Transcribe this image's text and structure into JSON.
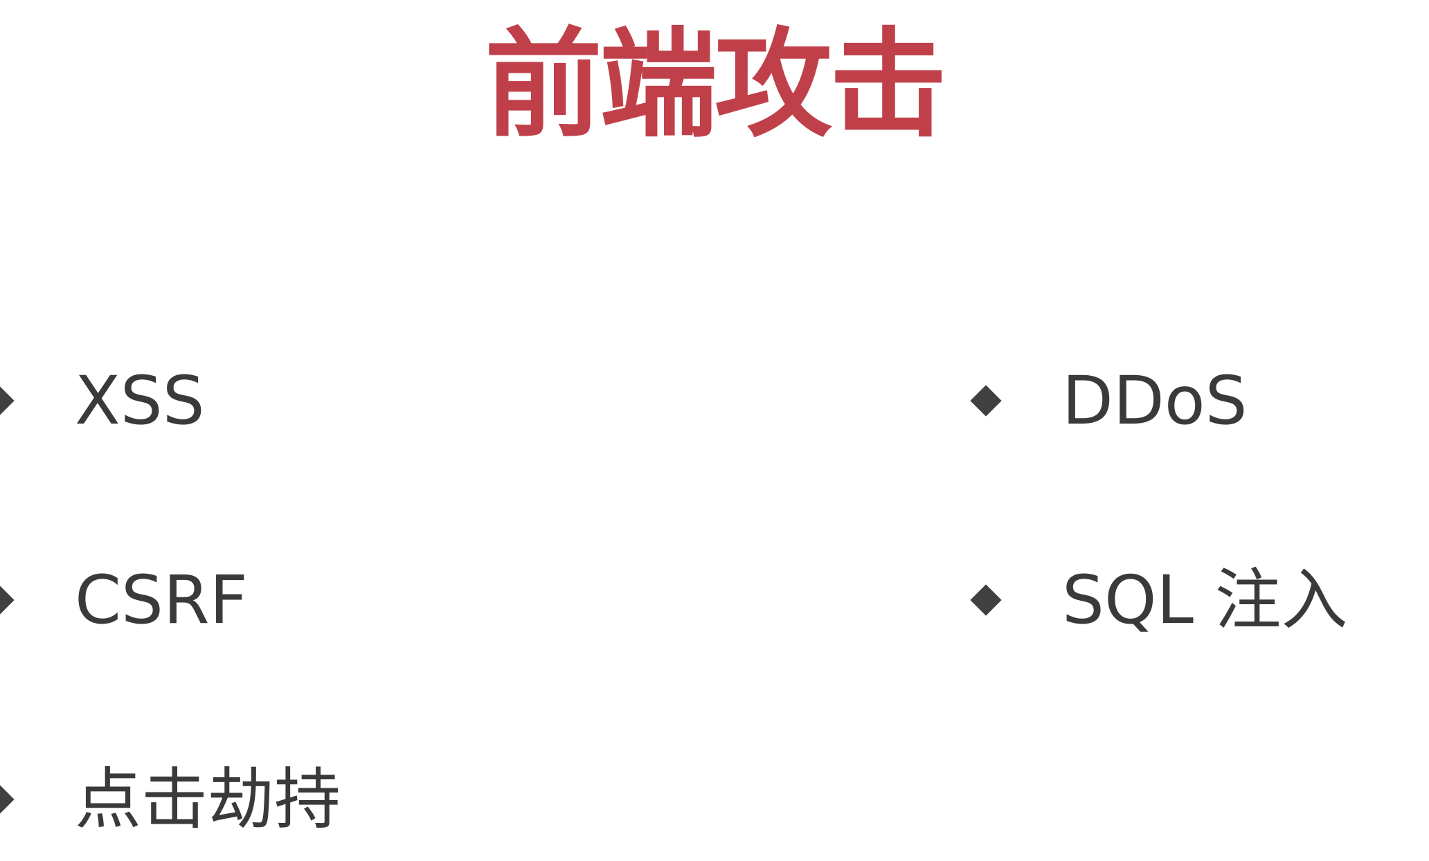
{
  "title": "前端攻击",
  "colors": {
    "title": "#c0404a",
    "text": "#3a3a3a",
    "bullet": "#404040"
  },
  "bullet_icon": "diamond-bullet-icon",
  "left_items": [
    {
      "label": "XSS"
    },
    {
      "label": "CSRF"
    },
    {
      "label": "点击劫持"
    }
  ],
  "right_items": [
    {
      "label": "DDoS"
    },
    {
      "label": "SQL 注入"
    }
  ]
}
